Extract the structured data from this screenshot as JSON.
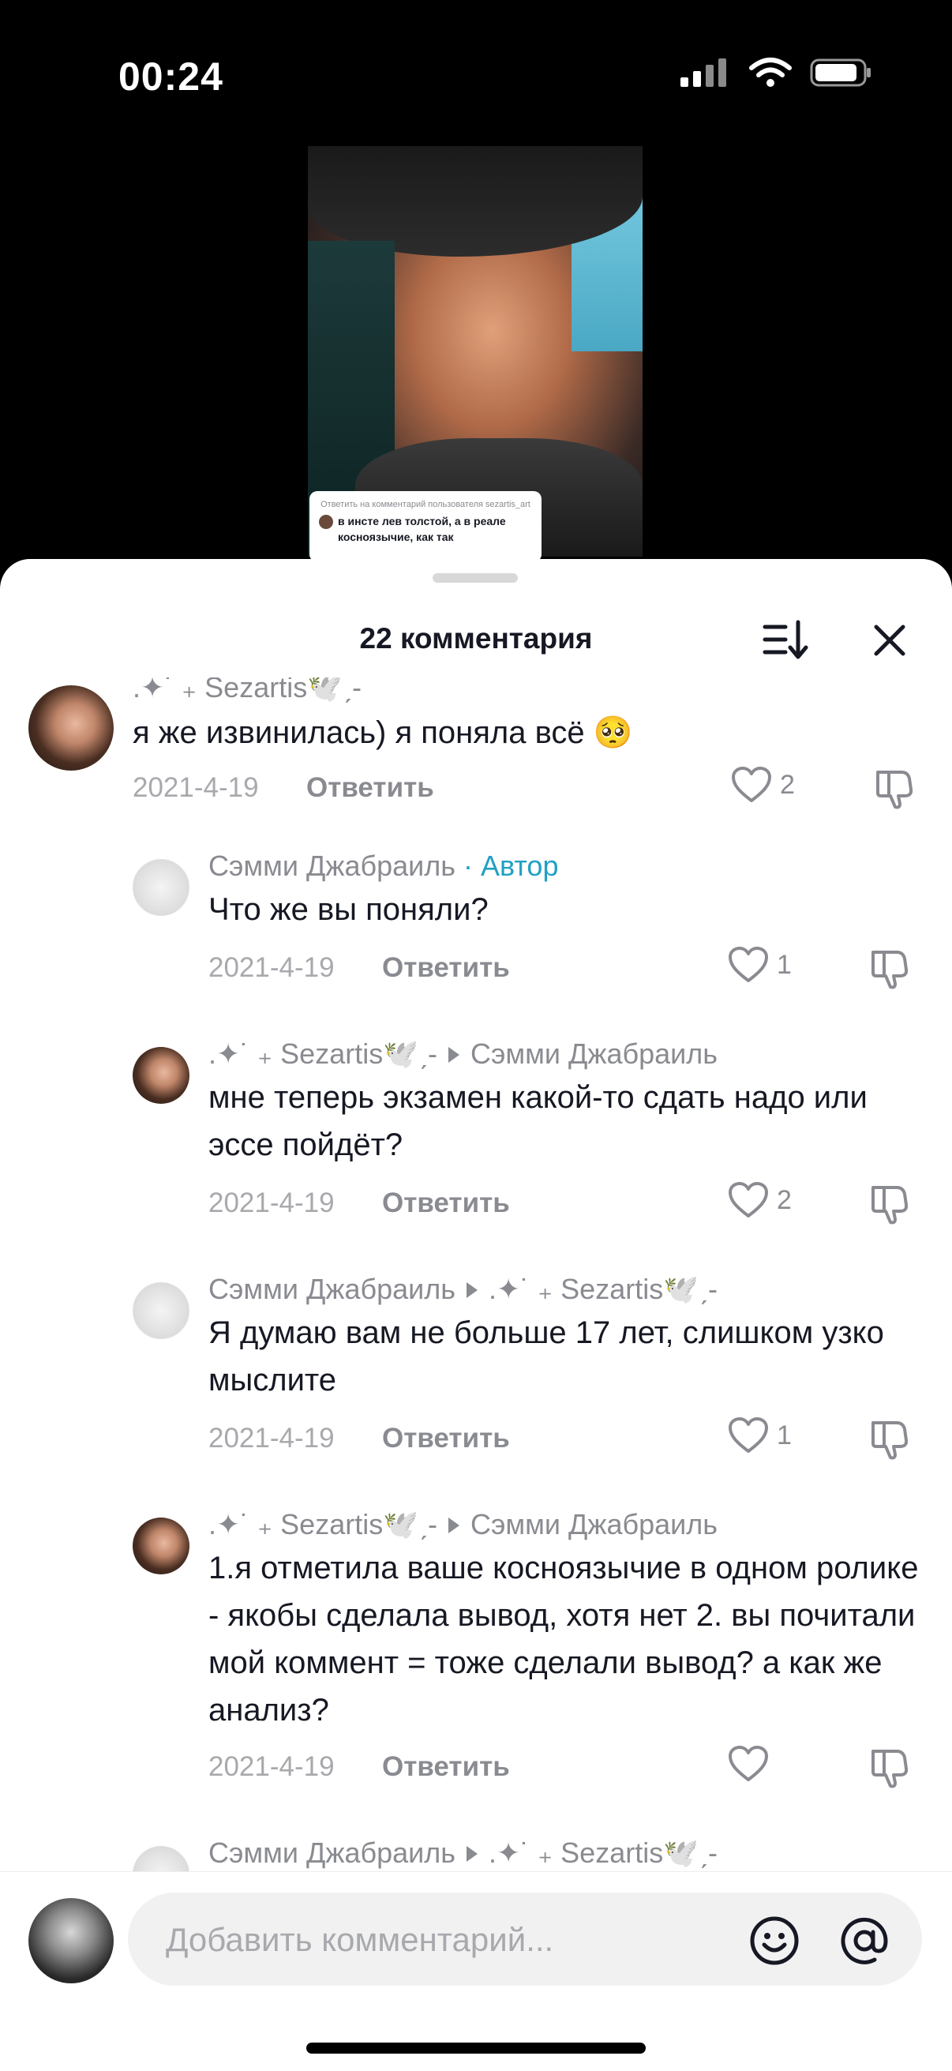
{
  "status_bar": {
    "time": "00:24"
  },
  "video": {
    "reply_card_header": "Ответить на комментарий пользователя sezartis_art",
    "reply_card_text": "в инсте лев толстой, а в реале косноязычие, как так"
  },
  "sheet": {
    "title": "22 комментария"
  },
  "comments": [
    {
      "author": ".✦˙ ₊ Sezartis🕊️ˏ-",
      "text": "я же извинилась) я поняла всё 🥺",
      "date": "2021-4-19",
      "reply": "Ответить",
      "likes": "2"
    },
    {
      "author": "Сэмми Джабраиль",
      "badge": "· Автор",
      "text": "Что же вы поняли?",
      "date": "2021-4-19",
      "reply": "Ответить",
      "likes": "1"
    },
    {
      "author": ".✦˙ ₊ Sezartis🕊️ˏ-",
      "reply_to": "Сэмми Джабраиль",
      "text": "мне теперь экзамен какой-то сдать надо или эссе пойдёт?",
      "date": "2021-4-19",
      "reply": "Ответить",
      "likes": "2"
    },
    {
      "author": "Сэмми Джабраиль",
      "reply_to": ".✦˙ ₊ Sezartis🕊️ˏ-",
      "text": "Я думаю вам не больше 17 лет, слишком узко мыслите",
      "date": "2021-4-19",
      "reply": "Ответить",
      "likes": "1"
    },
    {
      "author": ".✦˙ ₊ Sezartis🕊️ˏ-",
      "reply_to": "Сэмми Джабраиль",
      "text": "1.я отметила ваше косноязычие в одном ролике - якобы сделала вывод, хотя нет 2. вы почитали мой коммент = тоже сделали вывод? а как же анализ?",
      "date": "2021-4-19",
      "reply": "Ответить",
      "likes": ""
    },
    {
      "author": "Сэмми Джабраиль",
      "reply_to": ".✦˙ ₊ Sezartis🕊️ˏ-"
    }
  ],
  "composer": {
    "placeholder": "Добавить комментарий..."
  }
}
